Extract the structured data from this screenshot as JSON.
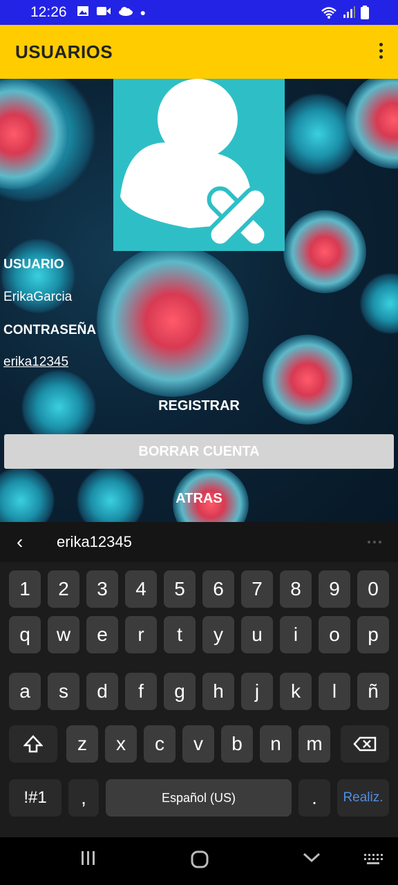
{
  "status_bar": {
    "time": "12:26",
    "battery_icon": "battery-icon",
    "wifi_icon": "wifi-icon"
  },
  "app_bar": {
    "title": "USUARIOS"
  },
  "form": {
    "usuario_label": "USUARIO",
    "usuario_value": "ErikaGarcia",
    "password_label": "CONTRASEÑA",
    "password_value": "erika12345"
  },
  "buttons": {
    "registrar": "REGISTRAR",
    "borrar": "BORRAR CUENTA",
    "atras": "ATRAS"
  },
  "keyboard": {
    "suggestion": "erika12345",
    "row_numbers": [
      "1",
      "2",
      "3",
      "4",
      "5",
      "6",
      "7",
      "8",
      "9",
      "0"
    ],
    "row_q": [
      "q",
      "w",
      "e",
      "r",
      "t",
      "y",
      "u",
      "i",
      "o",
      "p"
    ],
    "row_a": [
      "a",
      "s",
      "d",
      "f",
      "g",
      "h",
      "j",
      "k",
      "l",
      "ñ"
    ],
    "row_z": [
      "z",
      "x",
      "c",
      "v",
      "b",
      "n",
      "m"
    ],
    "symbols": "!#1",
    "comma": ",",
    "space": "Español (US)",
    "period": ".",
    "done": "Realiz."
  },
  "colors": {
    "status_bar": "#2323e6",
    "app_bar": "#ffcc00",
    "avatar_bg": "#2ebfc6",
    "done_key": "#4f8fe6"
  }
}
